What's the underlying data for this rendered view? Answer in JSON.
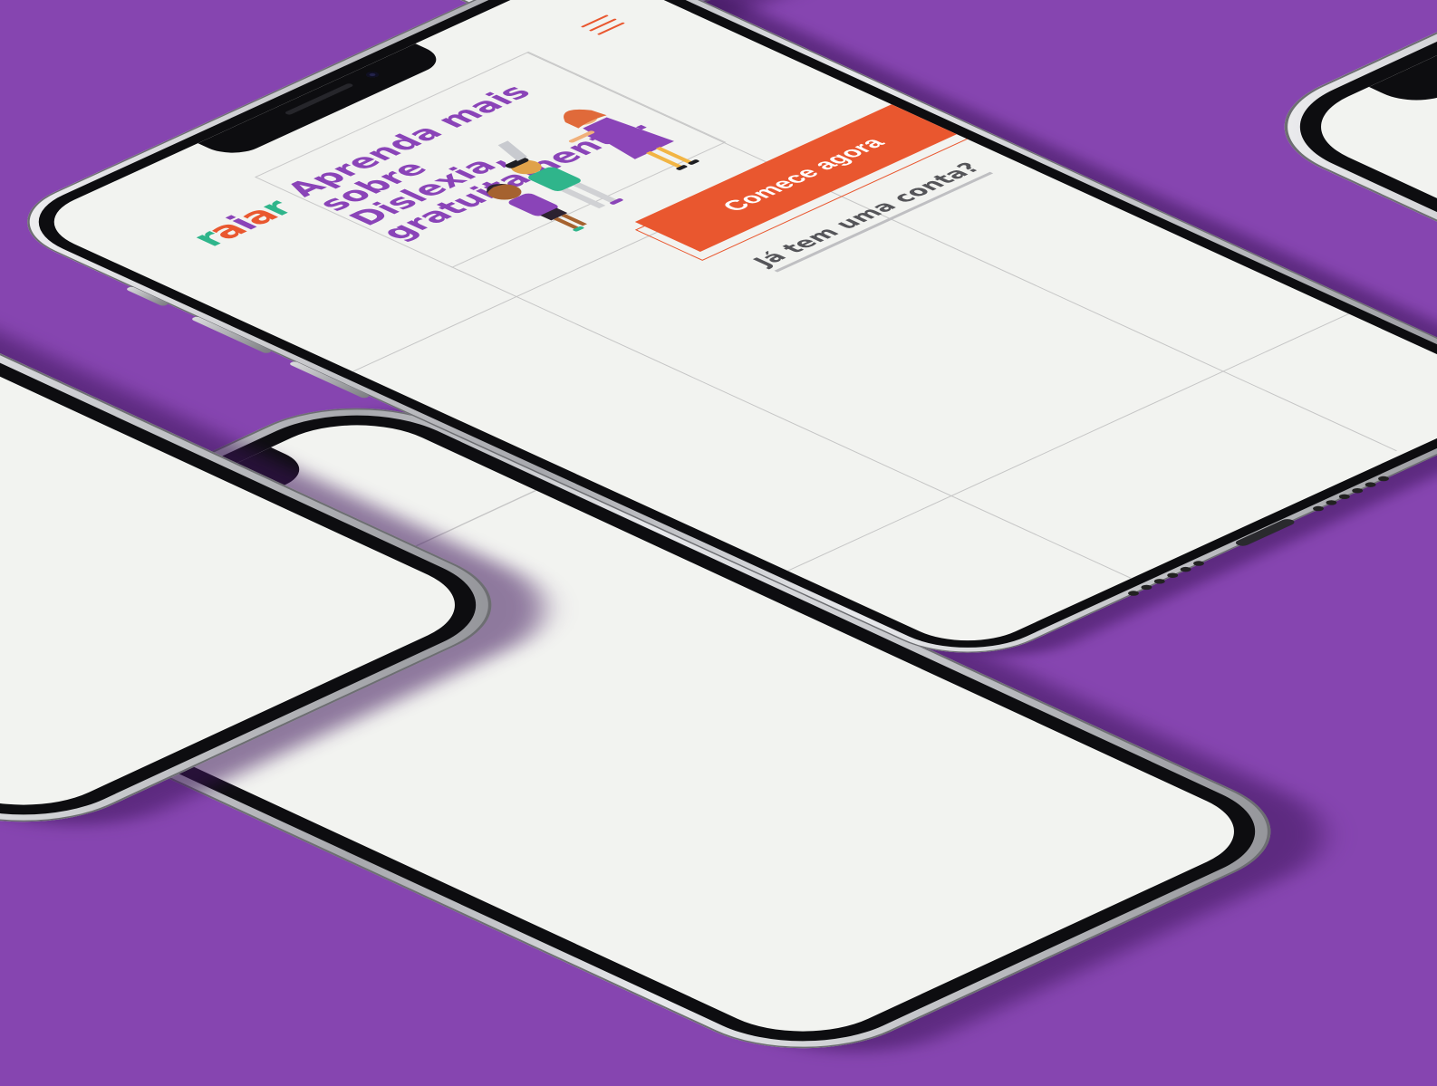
{
  "app": {
    "logo_letters": [
      "r",
      "a",
      "i",
      "a",
      "r"
    ],
    "logo_colors": [
      "#2fb58b",
      "#e9572f",
      "#8a44b8",
      "#e9572f",
      "#2fb58b"
    ],
    "menu_icon": "hamburger-icon"
  },
  "hero": {
    "headline_line1": "Aprenda mais",
    "headline_line2": "sobre Dislexia,",
    "headline_line3": "gratuitamente."
  },
  "actions": {
    "primary_cta": "Comece agora",
    "secondary_link": "Já tem uma conta?"
  },
  "colors": {
    "background": "#8645b0",
    "accent_orange": "#e9572f",
    "accent_purple": "#8a44b8",
    "accent_green": "#2fb58b",
    "screen": "#f2f3f0"
  }
}
